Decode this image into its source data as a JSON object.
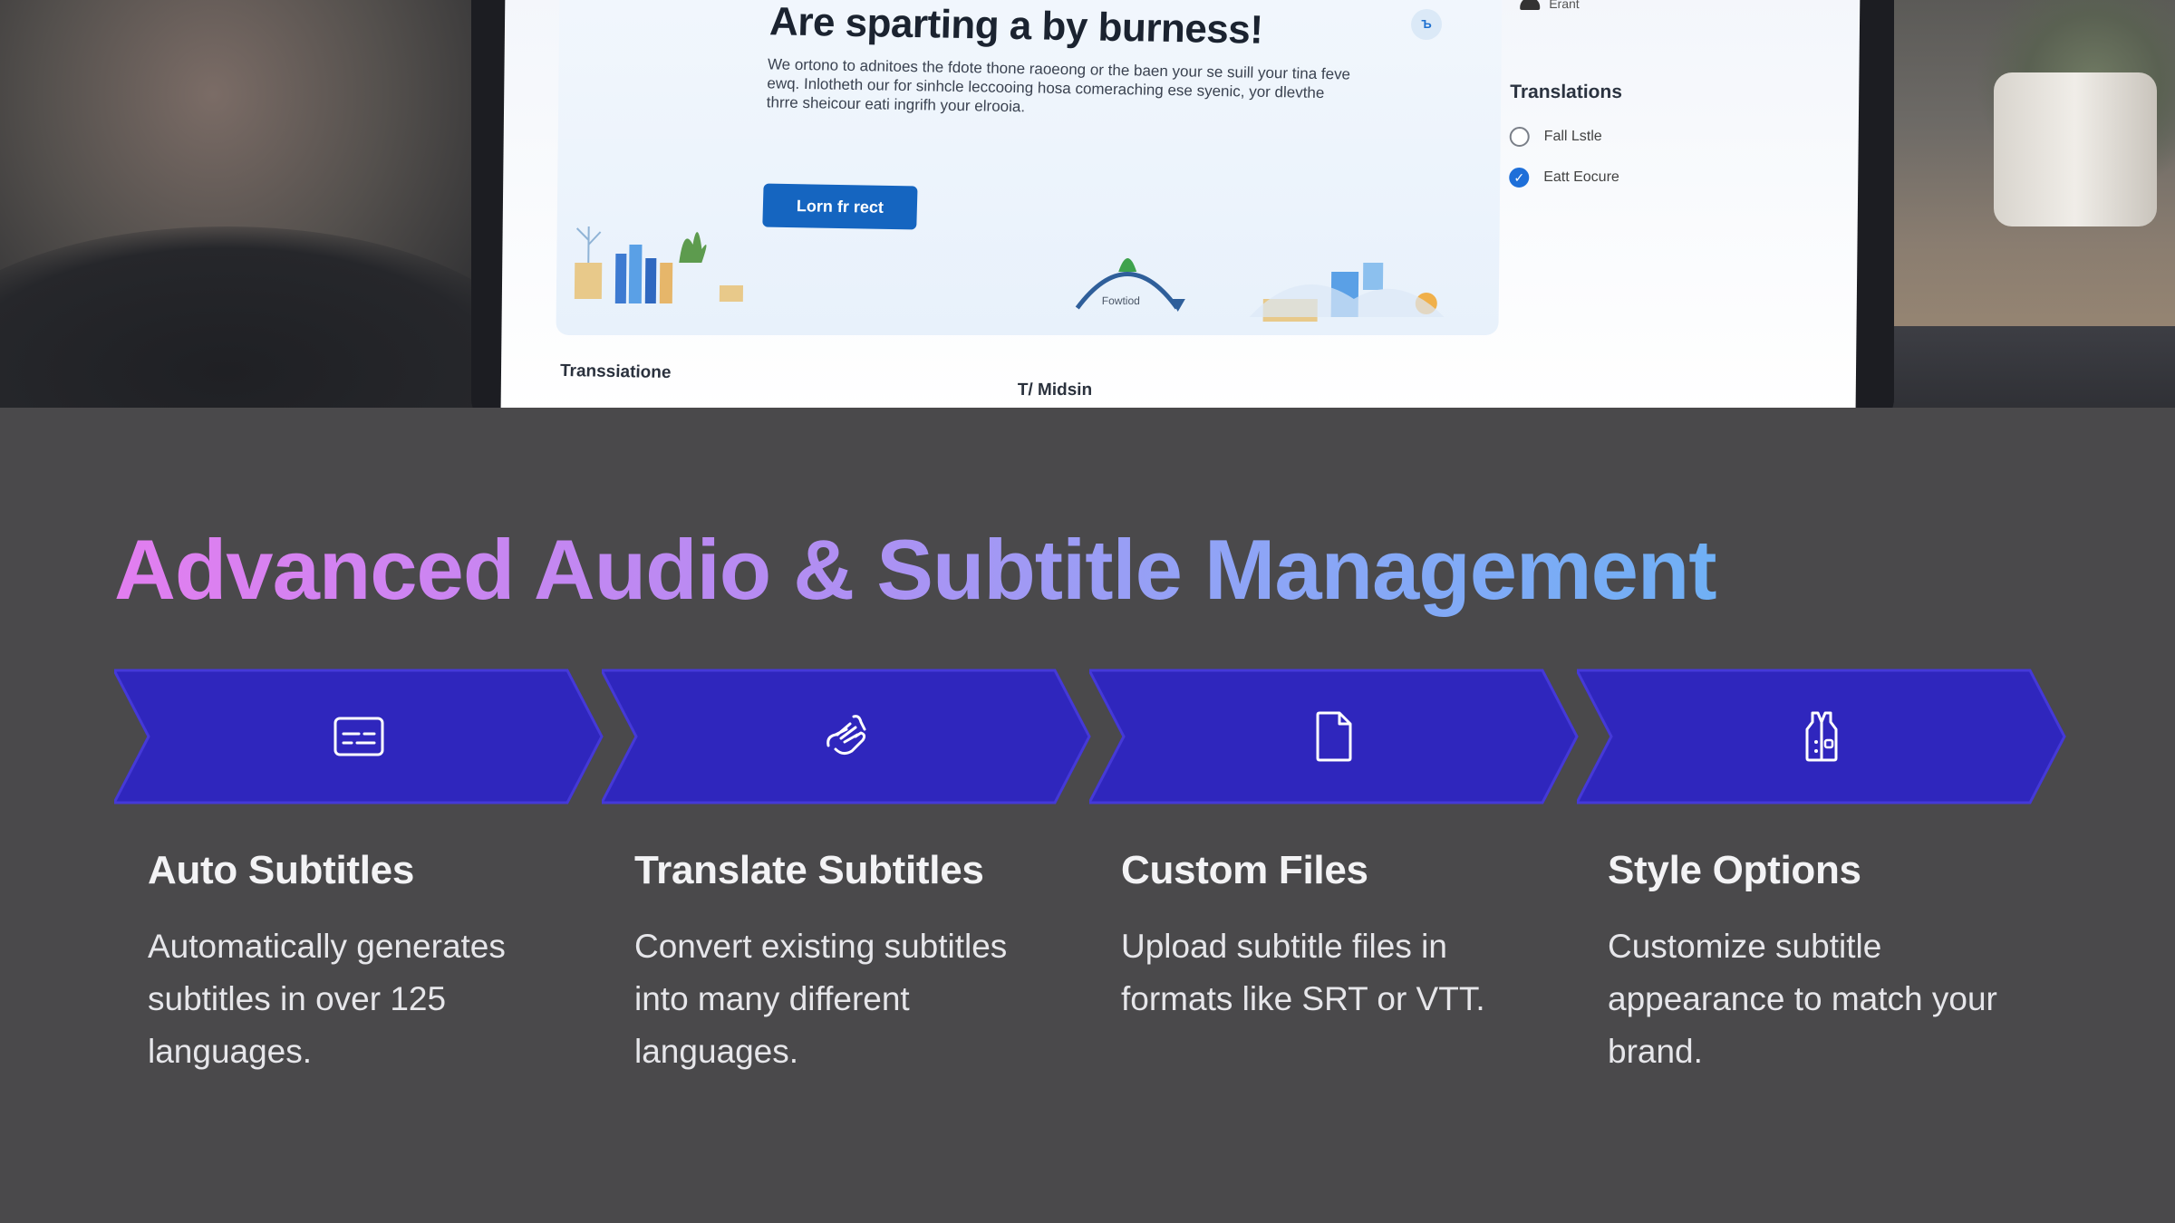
{
  "hero": {
    "screen": {
      "headline": "Are sparting a by burness!",
      "body": "We ortono to adnitoes the fdote thone raoeong or the baen your se suill your tina feve ewq. Inlotheth our for sinhcle leccooing hosa comeraching ese syenic, yor dlevthe thrre sheicour eati ingrifh your elrooia.",
      "button_label": "Lorn fr rect",
      "illustration_label": "Fowtiod",
      "footer_left": "Transsiatione",
      "footer_mid": "T/ Midsin",
      "side_user": "Erant",
      "side_title": "Translations",
      "options": [
        {
          "label": "Fall Lstle",
          "checked": false
        },
        {
          "label": "Eatt Eocure",
          "checked": true
        }
      ],
      "badge": "Ъ"
    }
  },
  "section": {
    "title": "Advanced Audio & Subtitle Management",
    "chevron_color": "#2f26bd",
    "chevron_border": "#4539d8",
    "features": [
      {
        "icon": "subtitles-icon",
        "title": "Auto Subtitles",
        "description": "Automatically generates subtitles in over 125 languages."
      },
      {
        "icon": "sign-language-icon",
        "title": "Translate Subtitles",
        "description": "Convert existing subtitles into many different languages."
      },
      {
        "icon": "file-icon",
        "title": "Custom Files",
        "description": "Upload subtitle files in formats like SRT or VTT."
      },
      {
        "icon": "vest-icon",
        "title": "Style Options",
        "description": "Customize subtitle appearance to match your brand."
      }
    ]
  }
}
